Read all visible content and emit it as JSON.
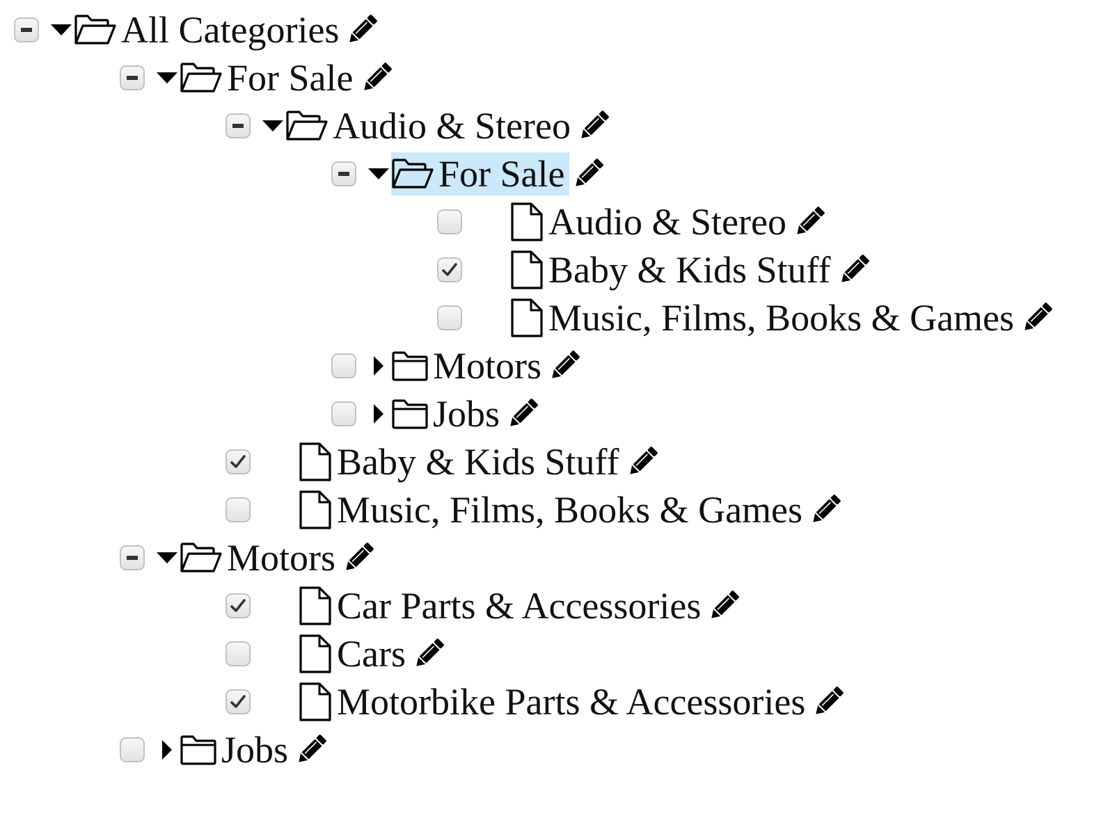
{
  "tree": {
    "nodes": [
      {
        "label": "All Categories",
        "level": 0,
        "kind": "folder",
        "expanded": true,
        "checkbox": "partial",
        "selected": false
      },
      {
        "label": "For Sale",
        "level": 1,
        "kind": "folder",
        "expanded": true,
        "checkbox": "partial",
        "selected": false
      },
      {
        "label": "Audio & Stereo",
        "level": 2,
        "kind": "folder",
        "expanded": true,
        "checkbox": "partial",
        "selected": false
      },
      {
        "label": "For Sale",
        "level": 3,
        "kind": "folder",
        "expanded": true,
        "checkbox": "partial",
        "selected": true
      },
      {
        "label": "Audio & Stereo",
        "level": 4,
        "kind": "file",
        "checkbox": "unchecked",
        "selected": false
      },
      {
        "label": "Baby & Kids Stuff",
        "level": 4,
        "kind": "file",
        "checkbox": "checked",
        "selected": false
      },
      {
        "label": "Music, Films, Books & Games",
        "level": 4,
        "kind": "file",
        "checkbox": "unchecked",
        "selected": false
      },
      {
        "label": "Motors",
        "level": 3,
        "kind": "folder",
        "expanded": false,
        "checkbox": "unchecked",
        "selected": false
      },
      {
        "label": "Jobs",
        "level": 3,
        "kind": "folder",
        "expanded": false,
        "checkbox": "unchecked",
        "selected": false
      },
      {
        "label": "Baby & Kids Stuff",
        "level": 2,
        "kind": "file",
        "checkbox": "checked",
        "selected": false
      },
      {
        "label": "Music, Films, Books & Games",
        "level": 2,
        "kind": "file",
        "checkbox": "unchecked",
        "selected": false
      },
      {
        "label": "Motors",
        "level": 1,
        "kind": "folder",
        "expanded": true,
        "checkbox": "partial",
        "selected": false
      },
      {
        "label": "Car Parts & Accessories",
        "level": 2,
        "kind": "file",
        "checkbox": "checked",
        "selected": false
      },
      {
        "label": "Cars",
        "level": 2,
        "kind": "file",
        "checkbox": "unchecked",
        "selected": false
      },
      {
        "label": "Motorbike Parts & Accessories",
        "level": 2,
        "kind": "file",
        "checkbox": "checked",
        "selected": false
      },
      {
        "label": "Jobs",
        "level": 1,
        "kind": "folder",
        "expanded": false,
        "checkbox": "unchecked",
        "selected": false
      }
    ]
  },
  "icons": {
    "folder_open": "folder-open-icon",
    "folder_closed": "folder-icon",
    "file": "file-icon",
    "edit": "pencil-icon",
    "expanded": "caret-down-icon",
    "collapsed": "caret-right-icon"
  },
  "colors": {
    "selection": "#cce8fb",
    "text": "#111111"
  }
}
